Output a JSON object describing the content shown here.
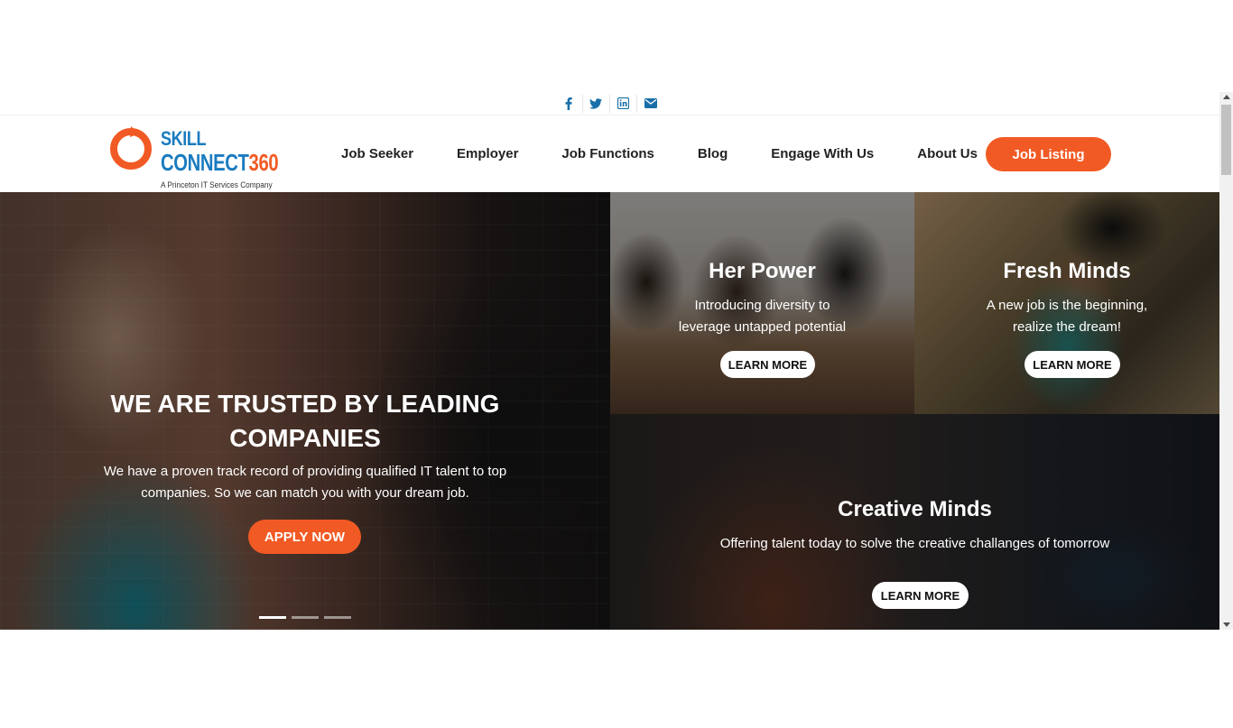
{
  "social": [
    {
      "name": "facebook-icon",
      "glyph": "f"
    },
    {
      "name": "twitter-icon",
      "glyph": "t"
    },
    {
      "name": "linkedin-icon",
      "glyph": "in"
    },
    {
      "name": "email-icon",
      "glyph": "@"
    }
  ],
  "brand": {
    "line1": "SKILL",
    "line2_text": "CONNECT",
    "line2_num": "360",
    "tagline": "A Princeton IT Services Company",
    "accent": "#f15a24",
    "blue": "#1a7bbf"
  },
  "nav": {
    "items": [
      "Job Seeker",
      "Employer",
      "Job Functions",
      "Blog",
      "Engage With Us",
      "About Us"
    ],
    "cta": "Job Listing"
  },
  "hero": {
    "title_line1": "WE ARE TRUSTED BY LEADING",
    "title_line2": "COMPANIES",
    "description": "We have a proven track record of providing qualified IT talent to top companies. So we can match you with your dream job.",
    "button": "APPLY NOW",
    "slides": 3,
    "active_slide": 1
  },
  "tiles": {
    "power": {
      "title": "Her Power",
      "desc_line1": "Introducing diversity to",
      "desc_line2": "leverage untapped potential",
      "button": "LEARN MORE"
    },
    "fresh": {
      "title": "Fresh Minds",
      "desc_line1": "A new job is the beginning,",
      "desc_line2": "realize the dream!",
      "button": "LEARN MORE"
    },
    "creative": {
      "title": "Creative Minds",
      "desc": "Offering talent today to solve the creative challanges of tomorrow",
      "button": "LEARN MORE"
    }
  }
}
